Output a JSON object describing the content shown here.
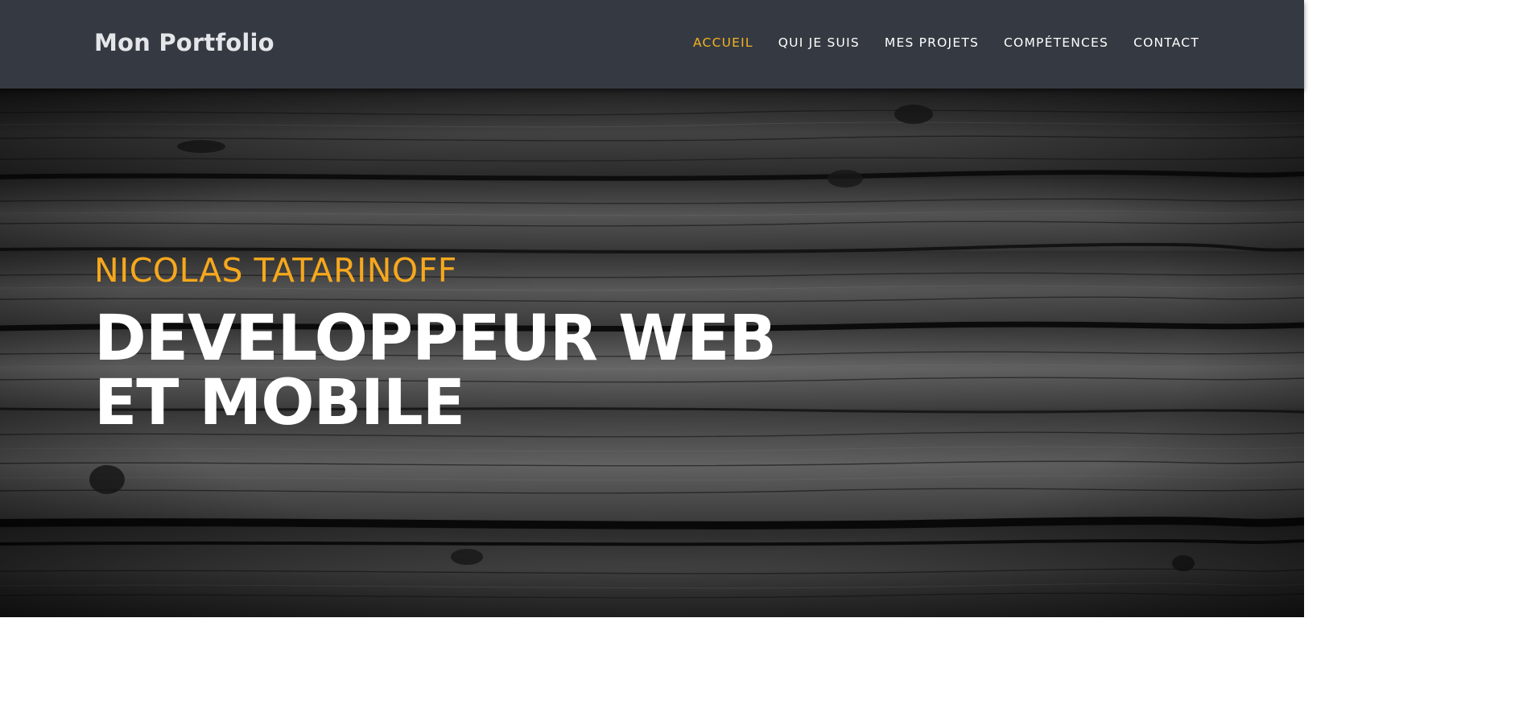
{
  "navbar": {
    "brand": "Mon Portfolio",
    "items": [
      {
        "label": "ACCUEIL",
        "active": true
      },
      {
        "label": "QUI JE SUIS",
        "active": false
      },
      {
        "label": "MES PROJETS",
        "active": false
      },
      {
        "label": "COMPÉTENCES",
        "active": false
      },
      {
        "label": "CONTACT",
        "active": false
      }
    ]
  },
  "hero": {
    "subtitle": "NICOLAS TATARINOFF",
    "title_line1": "DEVELOPPEUR WEB",
    "title_line2": "ET MOBILE"
  },
  "colors": {
    "navbar_bg": "#353a42",
    "accent": "#f6b321",
    "hero_text": "#ffffff"
  }
}
